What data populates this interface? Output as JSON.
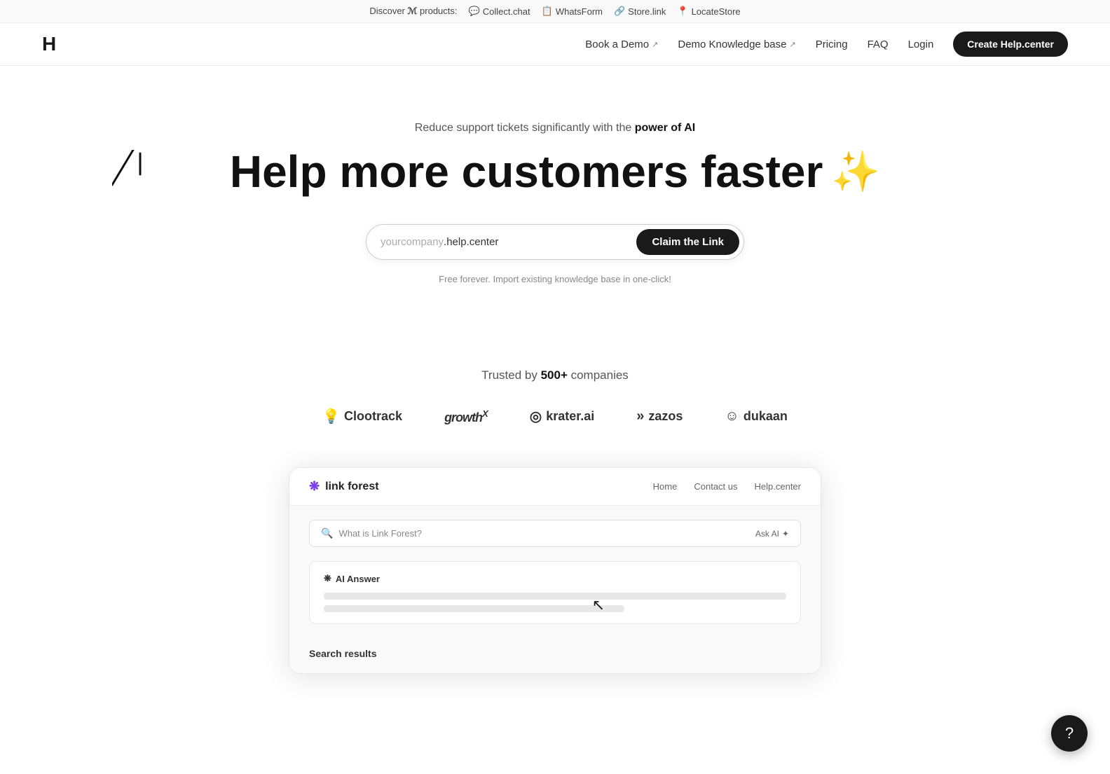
{
  "banner": {
    "discover_text": "Discover",
    "products_label": "products:",
    "products": [
      {
        "icon": "💬",
        "label": "Collect.chat",
        "url": "#"
      },
      {
        "icon": "📋",
        "label": "WhatsForm",
        "url": "#"
      },
      {
        "icon": "🔗",
        "label": "Store.link",
        "url": "#"
      },
      {
        "icon": "📍",
        "label": "LocateStore",
        "url": "#"
      }
    ]
  },
  "navbar": {
    "logo": "H",
    "links": [
      {
        "label": "Book a Demo",
        "external": true
      },
      {
        "label": "Demo Knowledge base",
        "external": true
      },
      {
        "label": "Pricing",
        "external": false
      },
      {
        "label": "FAQ",
        "external": false
      },
      {
        "label": "Login",
        "external": false
      }
    ],
    "cta_label": "Create Help.center"
  },
  "hero": {
    "subtitle_start": "Reduce support tickets significantly with the ",
    "subtitle_bold": "power of AI",
    "title_text": "Help more customers faster",
    "title_sparkle": "✨",
    "url_placeholder": "yourcompany",
    "url_suffix": ".help.center",
    "claim_button": "Claim the Link",
    "note": "Free forever. Import existing knowledge base in one-click!"
  },
  "trusted": {
    "label_start": "Trusted by ",
    "label_count": "500+",
    "label_end": " companies",
    "logos": [
      {
        "icon": "💡",
        "name": "Clootrack"
      },
      {
        "icon": "",
        "name": "growthX"
      },
      {
        "icon": "◎",
        "name": "krater.ai"
      },
      {
        "icon": "»",
        "name": "zazos"
      },
      {
        "icon": "☺",
        "name": "dukaan"
      }
    ]
  },
  "demo": {
    "logo_icon": "❋",
    "logo_text": "link forest",
    "nav_items": [
      "Home",
      "Contact us",
      "Help.center"
    ],
    "search_placeholder": "What is Link Forest?",
    "ask_ai_label": "Ask AI",
    "ai_answer_label": "AI Answer",
    "ai_answer_icon": "❋",
    "search_results_label": "Search results",
    "line_widths": [
      "100%",
      "65%"
    ]
  },
  "fab": {
    "icon": "?"
  }
}
